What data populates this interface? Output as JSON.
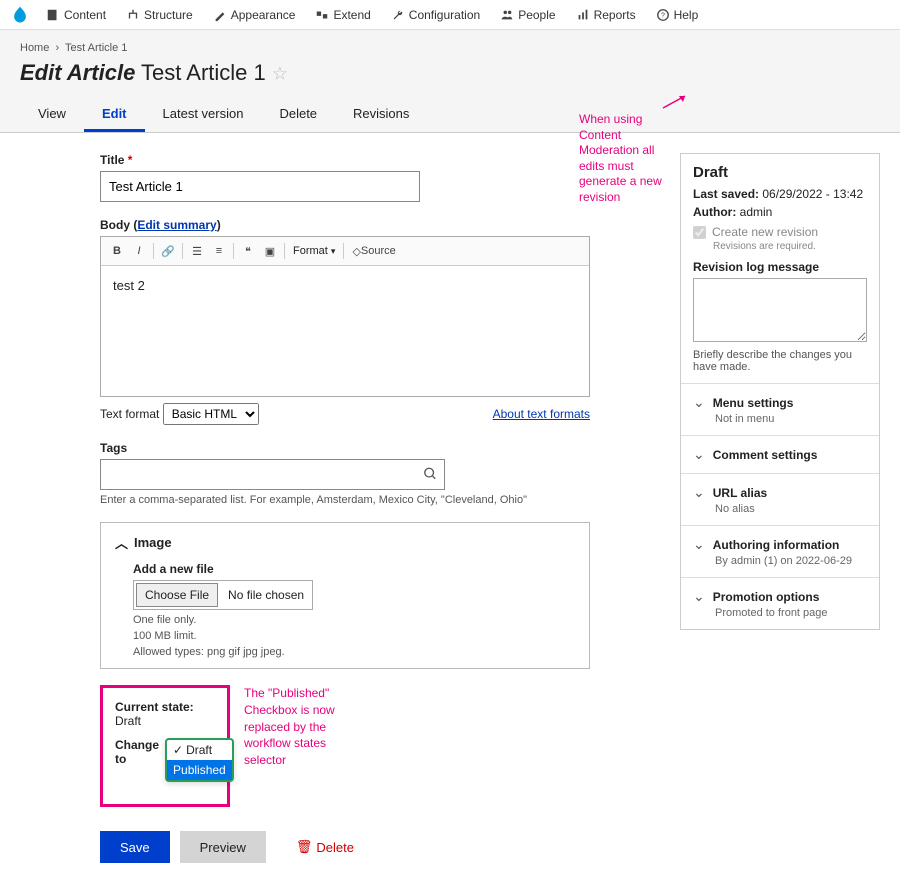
{
  "toolbar": [
    {
      "label": "Content"
    },
    {
      "label": "Structure"
    },
    {
      "label": "Appearance"
    },
    {
      "label": "Extend"
    },
    {
      "label": "Configuration"
    },
    {
      "label": "People"
    },
    {
      "label": "Reports"
    },
    {
      "label": "Help"
    }
  ],
  "breadcrumbs": {
    "home": "Home",
    "current": "Test Article 1"
  },
  "page_title": {
    "prefix": "Edit Article",
    "name": "Test Article 1"
  },
  "tabs": [
    {
      "label": "View"
    },
    {
      "label": "Edit",
      "active": true
    },
    {
      "label": "Latest version"
    },
    {
      "label": "Delete"
    },
    {
      "label": "Revisions"
    }
  ],
  "form": {
    "title_label": "Title",
    "title_value": "Test Article 1",
    "body_label": "Body",
    "edit_summary": "Edit summary",
    "body_content": "test 2",
    "format_dropdown_label": "Format",
    "source_label": "Source",
    "text_format_label": "Text format",
    "text_format_value": "Basic HTML",
    "about_formats": "About text formats",
    "tags_label": "Tags",
    "tags_help": "Enter a comma-separated list. For example, Amsterdam, Mexico City, \"Cleveland, Ohio\"",
    "image_label": "Image",
    "add_file_label": "Add a new file",
    "choose_file": "Choose File",
    "no_file": "No file chosen",
    "file_help1": "One file only.",
    "file_help2": "100 MB limit.",
    "file_help3": "Allowed types: png gif jpg jpeg."
  },
  "moderation": {
    "current_state_label": "Current state:",
    "current_state": "Draft",
    "change_to_label": "Change to",
    "opt_draft": "Draft",
    "opt_published": "Published"
  },
  "annotations": {
    "revision": "When using Content Moderation all edits must generate a new revision",
    "workflow": "The \"Published\" Checkbox is now replaced by the workflow states selector"
  },
  "actions": {
    "save": "Save",
    "preview": "Preview",
    "delete": "Delete"
  },
  "sidebar": {
    "status": "Draft",
    "last_saved_label": "Last saved:",
    "last_saved": "06/29/2022 - 13:42",
    "author_label": "Author:",
    "author": "admin",
    "create_rev": "Create new revision",
    "rev_required": "Revisions are required.",
    "rev_log_label": "Revision log message",
    "rev_log_help": "Briefly describe the changes you have made.",
    "menu": {
      "title": "Menu settings",
      "sub": "Not in menu"
    },
    "comment": {
      "title": "Comment settings"
    },
    "url": {
      "title": "URL alias",
      "sub": "No alias"
    },
    "authoring": {
      "title": "Authoring information",
      "sub": "By admin (1) on 2022-06-29"
    },
    "promotion": {
      "title": "Promotion options",
      "sub": "Promoted to front page"
    }
  }
}
